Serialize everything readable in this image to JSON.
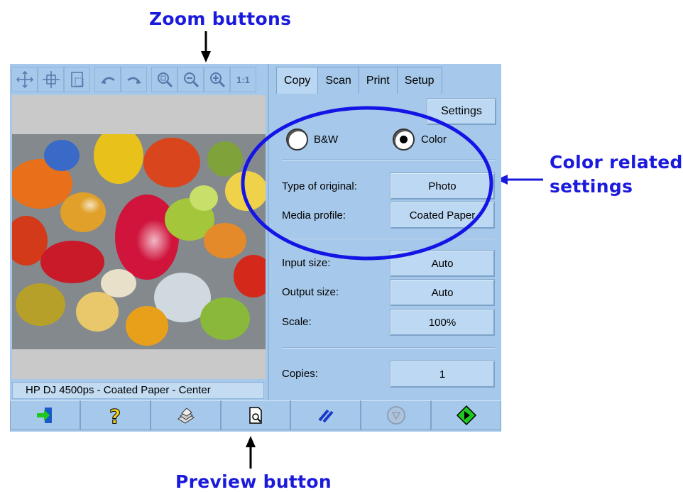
{
  "callouts": {
    "zoom": "Zoom buttons",
    "preview": "Preview button",
    "color_line1": "Color related",
    "color_line2": "settings"
  },
  "zoom_toolbar": {
    "icons": [
      "pan-icon",
      "move-icon",
      "fit-page-icon",
      "undo-rotate-icon",
      "redo-rotate-icon",
      "zoom-fit-icon",
      "zoom-out-icon",
      "zoom-in-icon",
      "actual-size-icon"
    ],
    "actual_size_label": "1:1"
  },
  "status_bar": {
    "text": "HP DJ 4500ps - Coated Paper - Center"
  },
  "tabs": [
    {
      "label": "Copy",
      "active": true
    },
    {
      "label": "Scan",
      "active": false
    },
    {
      "label": "Print",
      "active": false
    },
    {
      "label": "Setup",
      "active": false
    }
  ],
  "settings_button": "Settings",
  "color_mode": {
    "bw_label": "B&W",
    "color_label": "Color",
    "selected": "Color"
  },
  "fields": {
    "type_of_original": {
      "label": "Type of original:",
      "value": "Photo"
    },
    "media_profile": {
      "label": "Media profile:",
      "value": "Coated Paper"
    },
    "input_size": {
      "label": "Input size:",
      "value": "Auto"
    },
    "output_size": {
      "label": "Output size:",
      "value": "Auto"
    },
    "scale": {
      "label": "Scale:",
      "value": "100%"
    },
    "copies": {
      "label": "Copies:",
      "value": "1"
    }
  },
  "bottom_toolbar": {
    "icons": [
      "exit-icon",
      "help-icon",
      "media-icon",
      "preview-icon",
      "reset-icon",
      "stop-icon",
      "start-icon"
    ]
  },
  "colors": {
    "panel": "#a6c8ea",
    "callout_blue": "#1a1adc",
    "ellipse_blue": "#1414e6",
    "start_green": "#1fc81f"
  }
}
